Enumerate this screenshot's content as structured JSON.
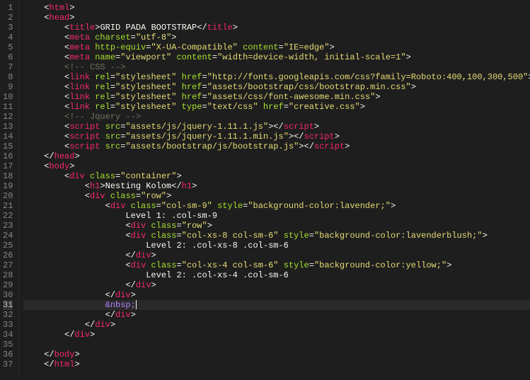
{
  "gutter": {
    "start": 1,
    "end": 37,
    "active": 31
  },
  "lines": [
    {
      "indent": 1,
      "tokens": [
        [
          "punct",
          "<"
        ],
        [
          "tag",
          "html"
        ],
        [
          "punct",
          ">"
        ]
      ]
    },
    {
      "indent": 1,
      "tokens": [
        [
          "punct",
          "<"
        ],
        [
          "tag",
          "head"
        ],
        [
          "punct",
          ">"
        ]
      ]
    },
    {
      "indent": 2,
      "tokens": [
        [
          "punct",
          "<"
        ],
        [
          "tag",
          "title"
        ],
        [
          "punct",
          ">"
        ],
        [
          "text",
          "GRID PADA BOOTSTRAP"
        ],
        [
          "punct",
          "</"
        ],
        [
          "tag",
          "title"
        ],
        [
          "punct",
          ">"
        ]
      ]
    },
    {
      "indent": 2,
      "tokens": [
        [
          "punct",
          "<"
        ],
        [
          "tag",
          "meta"
        ],
        [
          "text",
          " "
        ],
        [
          "attr",
          "charset"
        ],
        [
          "punct",
          "="
        ],
        [
          "string",
          "\"utf-8\""
        ],
        [
          "punct",
          ">"
        ]
      ]
    },
    {
      "indent": 2,
      "tokens": [
        [
          "punct",
          "<"
        ],
        [
          "tag",
          "meta"
        ],
        [
          "text",
          " "
        ],
        [
          "attr",
          "http-equiv"
        ],
        [
          "punct",
          "="
        ],
        [
          "string",
          "\"X-UA-Compatible\""
        ],
        [
          "text",
          " "
        ],
        [
          "attr",
          "content"
        ],
        [
          "punct",
          "="
        ],
        [
          "string",
          "\"IE=edge\""
        ],
        [
          "punct",
          ">"
        ]
      ]
    },
    {
      "indent": 2,
      "tokens": [
        [
          "punct",
          "<"
        ],
        [
          "tag",
          "meta"
        ],
        [
          "text",
          " "
        ],
        [
          "attr",
          "name"
        ],
        [
          "punct",
          "="
        ],
        [
          "string",
          "\"viewport\""
        ],
        [
          "text",
          " "
        ],
        [
          "attr",
          "content"
        ],
        [
          "punct",
          "="
        ],
        [
          "string",
          "\"width=device-width, initial-scale=1\""
        ],
        [
          "punct",
          ">"
        ]
      ]
    },
    {
      "indent": 2,
      "tokens": [
        [
          "comment",
          "<!-- CSS -->"
        ]
      ]
    },
    {
      "indent": 2,
      "tokens": [
        [
          "punct",
          "<"
        ],
        [
          "tag",
          "link"
        ],
        [
          "text",
          " "
        ],
        [
          "attr",
          "rel"
        ],
        [
          "punct",
          "="
        ],
        [
          "string",
          "\"stylesheet\""
        ],
        [
          "text",
          " "
        ],
        [
          "attr",
          "href"
        ],
        [
          "punct",
          "="
        ],
        [
          "string",
          "\"http://fonts.googleapis.com/css?family=Roboto:400,100,300,500\""
        ],
        [
          "punct",
          ">"
        ]
      ]
    },
    {
      "indent": 2,
      "tokens": [
        [
          "punct",
          "<"
        ],
        [
          "tag",
          "link"
        ],
        [
          "text",
          " "
        ],
        [
          "attr",
          "rel"
        ],
        [
          "punct",
          "="
        ],
        [
          "string",
          "\"stylesheet\""
        ],
        [
          "text",
          " "
        ],
        [
          "attr",
          "href"
        ],
        [
          "punct",
          "="
        ],
        [
          "string",
          "\"assets/bootstrap/css/bootstrap.min.css\""
        ],
        [
          "punct",
          ">"
        ]
      ]
    },
    {
      "indent": 2,
      "tokens": [
        [
          "punct",
          "<"
        ],
        [
          "tag",
          "link"
        ],
        [
          "text",
          " "
        ],
        [
          "attr",
          "rel"
        ],
        [
          "punct",
          "="
        ],
        [
          "string",
          "\"stylesheet\""
        ],
        [
          "text",
          " "
        ],
        [
          "attr",
          "href"
        ],
        [
          "punct",
          "="
        ],
        [
          "string",
          "\"assets/css/font-awesome.min.css\""
        ],
        [
          "punct",
          ">"
        ]
      ]
    },
    {
      "indent": 2,
      "tokens": [
        [
          "punct",
          "<"
        ],
        [
          "tag",
          "link"
        ],
        [
          "text",
          " "
        ],
        [
          "attr",
          "rel"
        ],
        [
          "punct",
          "="
        ],
        [
          "string",
          "\"stylesheet\""
        ],
        [
          "text",
          " "
        ],
        [
          "attr",
          "type"
        ],
        [
          "punct",
          "="
        ],
        [
          "string",
          "\"text/css\""
        ],
        [
          "text",
          " "
        ],
        [
          "attr",
          "href"
        ],
        [
          "punct",
          "="
        ],
        [
          "string",
          "\"creative.css\""
        ],
        [
          "punct",
          ">"
        ]
      ]
    },
    {
      "indent": 2,
      "tokens": [
        [
          "comment",
          "<!-- Jquery -->"
        ]
      ]
    },
    {
      "indent": 2,
      "tokens": [
        [
          "punct",
          "<"
        ],
        [
          "tag",
          "script"
        ],
        [
          "text",
          " "
        ],
        [
          "attr",
          "src"
        ],
        [
          "punct",
          "="
        ],
        [
          "string",
          "\"assets/js/jquery-1.11.1.js\""
        ],
        [
          "punct",
          "></"
        ],
        [
          "tag",
          "script"
        ],
        [
          "punct",
          ">"
        ]
      ]
    },
    {
      "indent": 2,
      "tokens": [
        [
          "punct",
          "<"
        ],
        [
          "tag",
          "script"
        ],
        [
          "text",
          " "
        ],
        [
          "attr",
          "src"
        ],
        [
          "punct",
          "="
        ],
        [
          "string",
          "\"assets/js/jquery-1.11.1.min.js\""
        ],
        [
          "punct",
          "></"
        ],
        [
          "tag",
          "script"
        ],
        [
          "punct",
          ">"
        ]
      ]
    },
    {
      "indent": 2,
      "tokens": [
        [
          "punct",
          "<"
        ],
        [
          "tag",
          "script"
        ],
        [
          "text",
          " "
        ],
        [
          "attr",
          "src"
        ],
        [
          "punct",
          "="
        ],
        [
          "string",
          "\"assets/bootstrap/js/bootstrap.js\""
        ],
        [
          "punct",
          "></"
        ],
        [
          "tag",
          "script"
        ],
        [
          "punct",
          ">"
        ]
      ]
    },
    {
      "indent": 1,
      "tokens": [
        [
          "punct",
          "</"
        ],
        [
          "tag",
          "head"
        ],
        [
          "punct",
          ">"
        ]
      ]
    },
    {
      "indent": 1,
      "tokens": [
        [
          "punct",
          "<"
        ],
        [
          "tag",
          "body"
        ],
        [
          "punct",
          ">"
        ]
      ]
    },
    {
      "indent": 2,
      "tokens": [
        [
          "punct",
          "<"
        ],
        [
          "tag",
          "div"
        ],
        [
          "text",
          " "
        ],
        [
          "attr",
          "class"
        ],
        [
          "punct",
          "="
        ],
        [
          "string",
          "\"container\""
        ],
        [
          "punct",
          ">"
        ]
      ]
    },
    {
      "indent": 3,
      "tokens": [
        [
          "punct",
          "<"
        ],
        [
          "tag",
          "h1"
        ],
        [
          "punct",
          ">"
        ],
        [
          "text",
          "Nesting Kolom"
        ],
        [
          "punct",
          "</"
        ],
        [
          "tag",
          "h1"
        ],
        [
          "punct",
          ">"
        ]
      ]
    },
    {
      "indent": 3,
      "tokens": [
        [
          "punct",
          "<"
        ],
        [
          "tag",
          "div"
        ],
        [
          "text",
          " "
        ],
        [
          "attr",
          "class"
        ],
        [
          "punct",
          "="
        ],
        [
          "string",
          "\"row\""
        ],
        [
          "punct",
          ">"
        ]
      ]
    },
    {
      "indent": 4,
      "tokens": [
        [
          "punct",
          "<"
        ],
        [
          "tag",
          "div"
        ],
        [
          "text",
          " "
        ],
        [
          "attr",
          "class"
        ],
        [
          "punct",
          "="
        ],
        [
          "string",
          "\"col-sm-9\""
        ],
        [
          "text",
          " "
        ],
        [
          "attr",
          "style"
        ],
        [
          "punct",
          "="
        ],
        [
          "string",
          "\"background-color:lavender;\""
        ],
        [
          "punct",
          ">"
        ]
      ]
    },
    {
      "indent": 5,
      "tokens": [
        [
          "text",
          "Level 1: .col-sm-9"
        ]
      ]
    },
    {
      "indent": 5,
      "tokens": [
        [
          "punct",
          "<"
        ],
        [
          "tag",
          "div"
        ],
        [
          "text",
          " "
        ],
        [
          "attr",
          "class"
        ],
        [
          "punct",
          "="
        ],
        [
          "string",
          "\"row\""
        ],
        [
          "punct",
          ">"
        ]
      ]
    },
    {
      "indent": 5,
      "tokens": [
        [
          "punct",
          "<"
        ],
        [
          "tag",
          "div"
        ],
        [
          "text",
          " "
        ],
        [
          "attr",
          "class"
        ],
        [
          "punct",
          "="
        ],
        [
          "string",
          "\"col-xs-8 col-sm-6\""
        ],
        [
          "text",
          " "
        ],
        [
          "attr",
          "style"
        ],
        [
          "punct",
          "="
        ],
        [
          "string",
          "\"background-color:lavenderblush;\""
        ],
        [
          "punct",
          ">"
        ]
      ]
    },
    {
      "indent": 6,
      "tokens": [
        [
          "text",
          "Level 2: .col-xs-8 .col-sm-6"
        ]
      ]
    },
    {
      "indent": 5,
      "tokens": [
        [
          "punct",
          "</"
        ],
        [
          "tag",
          "div"
        ],
        [
          "punct",
          ">"
        ]
      ]
    },
    {
      "indent": 5,
      "tokens": [
        [
          "punct",
          "<"
        ],
        [
          "tag",
          "div"
        ],
        [
          "text",
          " "
        ],
        [
          "attr",
          "class"
        ],
        [
          "punct",
          "="
        ],
        [
          "string",
          "\"col-xs-4 col-sm-6\""
        ],
        [
          "text",
          " "
        ],
        [
          "attr",
          "style"
        ],
        [
          "punct",
          "="
        ],
        [
          "string",
          "\"background-color:yellow;\""
        ],
        [
          "punct",
          ">"
        ]
      ]
    },
    {
      "indent": 6,
      "tokens": [
        [
          "text",
          "Level 2: .col-xs-4 .col-sm-6"
        ]
      ]
    },
    {
      "indent": 5,
      "tokens": [
        [
          "punct",
          "</"
        ],
        [
          "tag",
          "div"
        ],
        [
          "punct",
          ">"
        ]
      ]
    },
    {
      "indent": 4,
      "tokens": [
        [
          "punct",
          "</"
        ],
        [
          "tag",
          "div"
        ],
        [
          "punct",
          ">"
        ]
      ]
    },
    {
      "indent": 4,
      "tokens": [
        [
          "entity",
          "&nbsp;"
        ]
      ],
      "cursor": true
    },
    {
      "indent": 4,
      "tokens": [
        [
          "punct",
          "</"
        ],
        [
          "tag",
          "div"
        ],
        [
          "punct",
          ">"
        ]
      ]
    },
    {
      "indent": 3,
      "tokens": [
        [
          "punct",
          "</"
        ],
        [
          "tag",
          "div"
        ],
        [
          "punct",
          ">"
        ]
      ]
    },
    {
      "indent": 2,
      "tokens": [
        [
          "punct",
          "</"
        ],
        [
          "tag",
          "div"
        ],
        [
          "punct",
          ">"
        ]
      ]
    },
    {
      "indent": 0,
      "tokens": []
    },
    {
      "indent": 1,
      "tokens": [
        [
          "punct",
          "</"
        ],
        [
          "tag",
          "body"
        ],
        [
          "punct",
          ">"
        ]
      ]
    },
    {
      "indent": 1,
      "tokens": [
        [
          "punct",
          "</"
        ],
        [
          "tag",
          "html"
        ],
        [
          "punct",
          ">"
        ]
      ]
    }
  ]
}
